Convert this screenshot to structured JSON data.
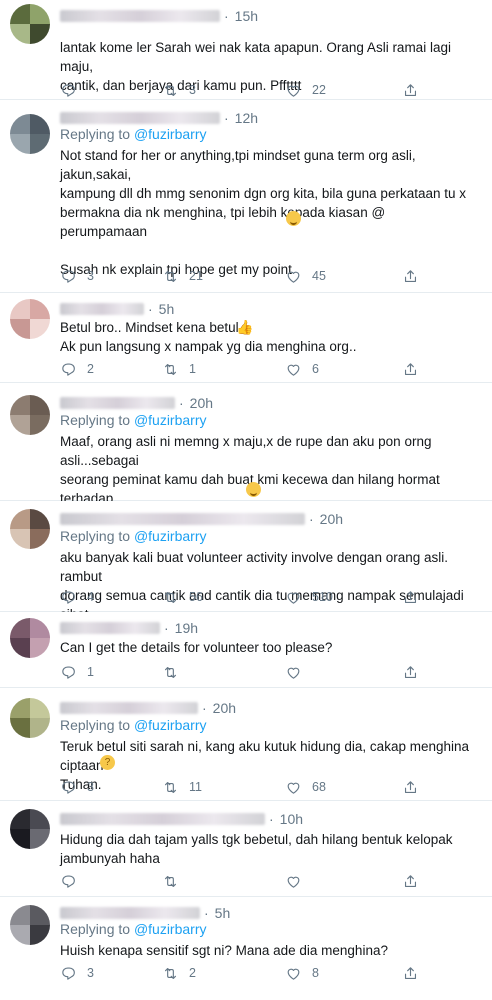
{
  "colors": {
    "text": "#14171a",
    "muted": "#657786",
    "link": "#1da1f2",
    "divider": "#e6ecf0"
  },
  "icons": {
    "reply": "reply-icon",
    "retweet": "retweet-icon",
    "like": "heart-icon",
    "share": "share-icon"
  },
  "replying_prefix": "Replying to",
  "tweets": [
    {
      "time": "15h",
      "replying_to": "",
      "text": "lantak kome ler Sarah wei nak kata apapun. Orang Asli ramai lagi maju,\ncantik, dan berjaya dari kamu pun. Pfftttt",
      "replies": "",
      "retweets": "3",
      "likes": "22"
    },
    {
      "time": "12h",
      "replying_to": "@fuzirbarry",
      "text": "Not stand for her or anything,tpi mindset guna term org asli, jakun,sakai,\nkampung dll dh mmg senonim dgn org kita, bila guna perkataan tu x\nbermakna dia nk menghina, tpi lebih kepada kiasan @  perumpamaan\n\nSusah nk explain tpi hope get my point \n\nSorry if my tweet are offensiv",
      "replies": "3",
      "retweets": "21",
      "likes": "45"
    },
    {
      "time": "5h",
      "replying_to": "",
      "text": "Betul bro.. Mindset kena betul.. \nAk pun langsung x nampak yg dia menghina org..",
      "replies": "2",
      "retweets": "1",
      "likes": "6"
    },
    {
      "time": "20h",
      "replying_to": "@fuzirbarry",
      "text": "Maaf, orang asli ni memng x maju,x de rupe dan aku pon orng asli...sebagai\nseorang peminat kamu dah buat kmi kecewa dan hilang hormat terhadap\nkamu....ambik cermin dan nilai diri sendri....dia x sedor dulu dia pon idong\nkembang setaman...lupa agknya...",
      "replies": "",
      "retweets": "",
      "likes": ""
    },
    {
      "time": "20h",
      "replying_to": "@fuzirbarry",
      "text": "aku banyak kali buat volunteer activity involve dengan orang asli. rambut\ndorang semua cantik and cantik dia tu memang nampak semulajadi sihat",
      "replies": "4",
      "retweets": "56",
      "likes": "510"
    },
    {
      "time": "19h",
      "replying_to": "",
      "text": "Can I get the details for volunteer too please?",
      "replies": "1",
      "retweets": "",
      "likes": ""
    },
    {
      "time": "20h",
      "replying_to": "@fuzirbarry",
      "text": "Teruk betul siti sarah ni, kang aku kutuk hidung dia, cakap menghina ciptaan\nTuhan. ",
      "replies": "3",
      "retweets": "11",
      "likes": "68"
    },
    {
      "time": "10h",
      "replying_to": "",
      "text": "Hidung dia dah tajam yalls tgk bebetul, dah hilang bentuk kelopak\njambunyah haha",
      "replies": "",
      "retweets": "",
      "likes": ""
    },
    {
      "time": "5h",
      "replying_to": "@fuzirbarry",
      "text": "Huish kenapa sensitif sgt ni? Mana ade dia menghina?",
      "replies": "3",
      "retweets": "2",
      "likes": "8"
    }
  ]
}
